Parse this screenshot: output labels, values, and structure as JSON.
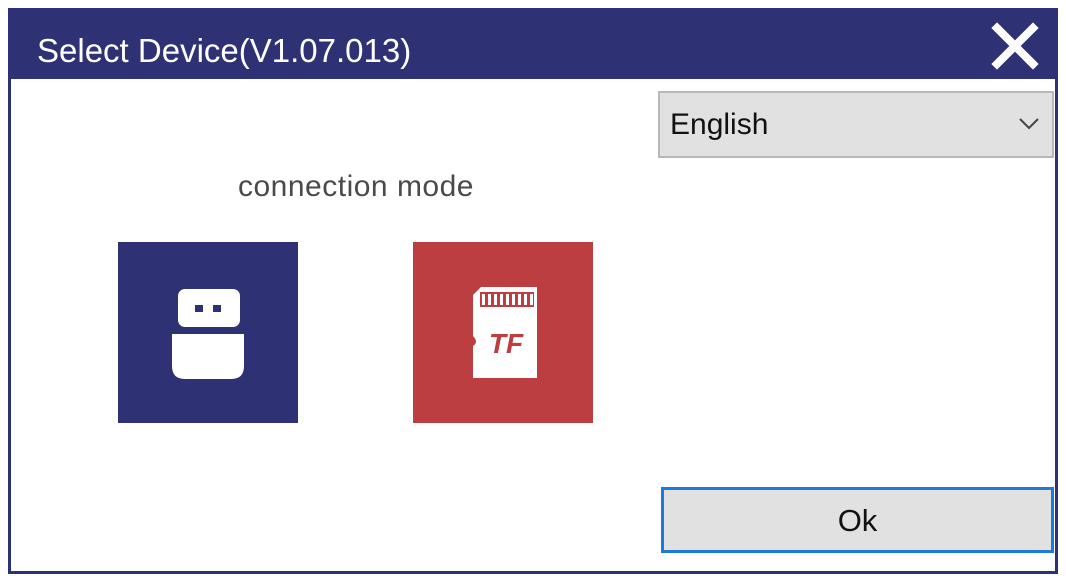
{
  "window": {
    "title": "Select Device(V1.07.013)",
    "close_icon": "close-icon"
  },
  "language": {
    "selected": "English",
    "dropdown_icon": "chevron-down-icon"
  },
  "connection": {
    "label": "connection mode",
    "modes": [
      {
        "icon": "usb-icon",
        "color": "#2e3174"
      },
      {
        "icon": "tf-card-icon",
        "badge": "TF",
        "color": "#bc3e40"
      }
    ]
  },
  "footer": {
    "ok_label": "Ok"
  },
  "colors": {
    "title_bar": "#2e3174",
    "ok_focus_border": "#1e7ad2"
  }
}
